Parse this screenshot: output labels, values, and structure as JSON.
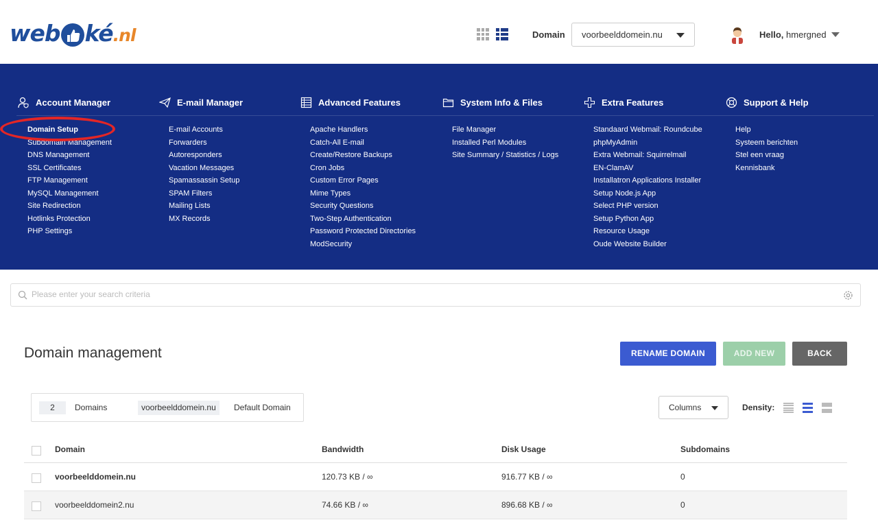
{
  "header": {
    "logo": {
      "part1": "web",
      "part2": "ké",
      "suffix": ".nl"
    },
    "domain_label": "Domain",
    "domain_selected": "voorbeelddomein.nu",
    "greeting": "Hello,",
    "username": "hmergned"
  },
  "nav": {
    "columns": [
      {
        "title": "Account Manager",
        "icon": "user-shield-icon",
        "items": [
          "Domain Setup",
          "Subdomain Management",
          "DNS Management",
          "SSL Certificates",
          "FTP Management",
          "MySQL Management",
          "Site Redirection",
          "Hotlinks Protection",
          "PHP Settings"
        ]
      },
      {
        "title": "E-mail Manager",
        "icon": "paper-plane-icon",
        "items": [
          "E-mail Accounts",
          "Forwarders",
          "Autoresponders",
          "Vacation Messages",
          "Spamassassin Setup",
          "SPAM Filters",
          "Mailing Lists",
          "MX Records"
        ]
      },
      {
        "title": "Advanced Features",
        "icon": "table-icon",
        "items": [
          "Apache Handlers",
          "Catch-All E-mail",
          "Create/Restore Backups",
          "Cron Jobs",
          "Custom Error Pages",
          "Mime Types",
          "Security Questions",
          "Two-Step Authentication",
          "Password Protected Directories",
          "ModSecurity"
        ]
      },
      {
        "title": "System Info & Files",
        "icon": "folder-icon",
        "items": [
          "File Manager",
          "Installed Perl Modules",
          "Site Summary / Statistics / Logs"
        ]
      },
      {
        "title": "Extra Features",
        "icon": "plus-icon",
        "items": [
          "Standaard Webmail: Roundcube",
          "phpMyAdmin",
          "Extra Webmail: Squirrelmail",
          "EN-ClamAV",
          "Installatron Applications Installer",
          "Setup Node.js App",
          "Select PHP version",
          "Setup Python App",
          "Resource Usage",
          "Oude Website Builder"
        ]
      },
      {
        "title": "Support & Help",
        "icon": "lifebuoy-icon",
        "items": [
          "Help",
          "Systeem berichten",
          "Stel een vraag",
          "Kennisbank"
        ]
      }
    ]
  },
  "search": {
    "placeholder": "Please enter your search criteria"
  },
  "page": {
    "title": "Domain management",
    "buttons": {
      "rename": "RENAME DOMAIN",
      "add": "ADD NEW",
      "back": "BACK"
    }
  },
  "info": {
    "count": "2",
    "count_label": "Domains",
    "default_domain": "voorbeelddomein.nu",
    "default_label": "Default Domain"
  },
  "controls": {
    "columns_label": "Columns",
    "density_label": "Density:"
  },
  "table": {
    "headers": [
      "Domain",
      "Bandwidth",
      "Disk Usage",
      "Subdomains"
    ],
    "rows": [
      {
        "domain": "voorbeelddomein.nu",
        "bandwidth": "120.73 KB / ∞",
        "disk": "916.77 KB / ∞",
        "subdomains": "0"
      },
      {
        "domain": "voorbeelddomein2.nu",
        "bandwidth": "74.66 KB / ∞",
        "disk": "896.68 KB / ∞",
        "subdomains": "0"
      }
    ]
  },
  "colors": {
    "nav_bg": "#142d84",
    "rename_btn": "#3b5bd1",
    "add_btn": "#9ccfa9",
    "back_btn": "#666666",
    "highlight": "#e32626"
  }
}
